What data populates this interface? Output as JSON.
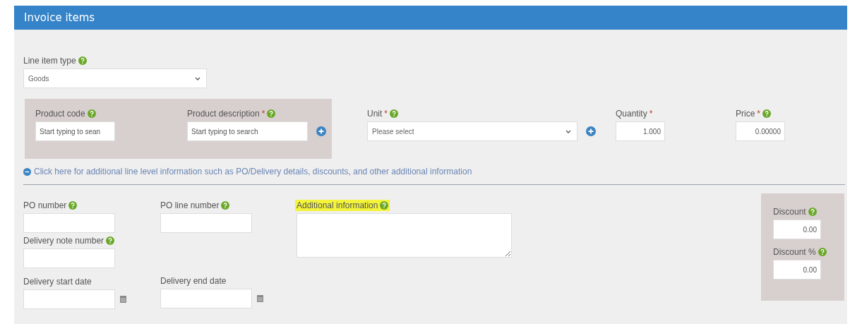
{
  "panel_title": "Invoice items",
  "line_item_type": {
    "label": "Line item type",
    "help": true,
    "value": "Goods"
  },
  "product": [
    {
      "label": "Product code",
      "help": true,
      "placeholder": "Start typing to sean",
      "add": false
    },
    {
      "label": "Product description",
      "required_mark": "*",
      "help": true,
      "placeholder": "Start typing to search",
      "add": true
    }
  ],
  "unit": {
    "label": "Unit",
    "required_mark": "*",
    "help": true,
    "value": "Please select",
    "add": true
  },
  "quantity": {
    "label": "Quantity",
    "required_mark": "*",
    "help": false,
    "value": "1.000"
  },
  "price": {
    "label": "Price",
    "required_mark": "*",
    "help": true,
    "value": "0.00000"
  },
  "details_link": {
    "text": "Click here for additional line level information such as PO/Delivery details, discounts, and other additional information",
    "expanded": true
  },
  "po_number": {
    "label": "PO number",
    "help": true
  },
  "delivery_note_number": {
    "label": "Delivery note number",
    "help": true
  },
  "delivery_start_date": {
    "label": "Delivery start date",
    "help": false
  },
  "po_line_number": {
    "label": "PO line number",
    "help": true
  },
  "delivery_end_date": {
    "label": "Delivery end date",
    "help": false
  },
  "additional_information": {
    "label": "Additional information",
    "help": true,
    "highlighted": true
  },
  "discount": {
    "label": "Discount",
    "help": true,
    "value": "0.00"
  },
  "discount_percent": {
    "label": "Discount %",
    "help": true,
    "value": "0.00"
  }
}
